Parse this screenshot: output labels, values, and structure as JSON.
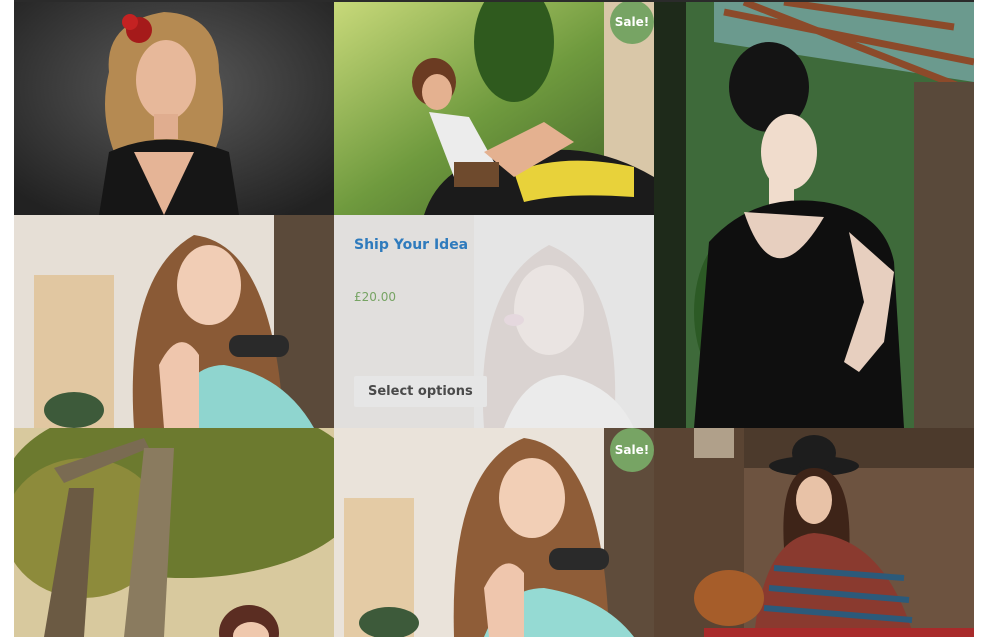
{
  "products": [
    {
      "image_icon": "woman-red-flower-portrait-photo"
    },
    {
      "image_icon": "woman-on-motorcycle-photo",
      "badge": "Sale!"
    },
    {
      "image_icon": "woman-black-lace-dress-photo"
    },
    {
      "image_icon": "woman-sunglasses-street-photo"
    },
    {
      "image_icon": "woman-portrait-photo",
      "title": "Ship Your Idea",
      "price": "£20.00",
      "button_label": "Select options"
    },
    {
      "image_icon": "woman-under-tree-photo"
    },
    {
      "image_icon": "woman-sunglasses-street-photo",
      "badge": "Sale!"
    },
    {
      "image_icon": "woman-bohemian-hat-photo"
    }
  ],
  "colors": {
    "sale_badge": "#77a464",
    "title_link": "#2f7bbd",
    "price": "#77a464",
    "button_bg": "#e6e6e6"
  }
}
